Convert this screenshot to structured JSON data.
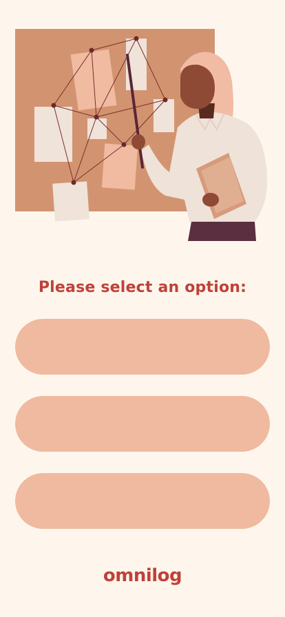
{
  "prompt": {
    "text": "Please select an option:"
  },
  "options": [
    {
      "label": ""
    },
    {
      "label": ""
    },
    {
      "label": ""
    }
  ],
  "brand": {
    "logo_text": "omnilog"
  },
  "colors": {
    "background": "#FEF6EC",
    "accent": "#C0413A",
    "option_fill": "#EFBAA0",
    "board": "#D29470"
  },
  "illustration": {
    "subject": "woman-presenting-at-board-illustration"
  }
}
